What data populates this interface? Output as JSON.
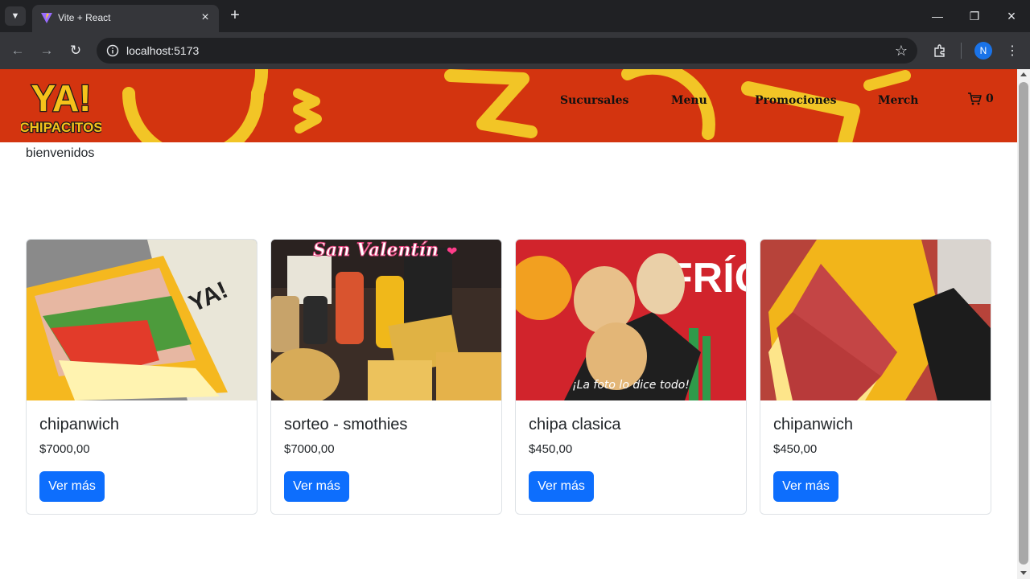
{
  "browser": {
    "tab_title": "Vite + React",
    "url": "localhost:5173",
    "profile_initial": "N"
  },
  "header": {
    "logo_text": [
      "YA!",
      "CHIPACITOS"
    ],
    "nav": [
      "Sucursales",
      "Menu",
      "Promociones",
      "Merch"
    ],
    "cart_count": "0"
  },
  "welcome": "bienvenidos",
  "products": [
    {
      "name": "chipanwich",
      "price": "$7000,00",
      "button": "Ver más"
    },
    {
      "name": "sorteo - smothies",
      "price": "$7000,00",
      "button": "Ver más",
      "image_text": "San Valentín"
    },
    {
      "name": "chipa clasica",
      "price": "$450,00",
      "button": "Ver más",
      "image_text": [
        "¡La foto lo dice todo!",
        "FRÍO"
      ]
    },
    {
      "name": "chipanwich",
      "price": "$450,00",
      "button": "Ver más"
    }
  ],
  "colors": {
    "header_bg": "#d3340f",
    "header_accent": "#f2c526",
    "button": "#0d6efd"
  }
}
